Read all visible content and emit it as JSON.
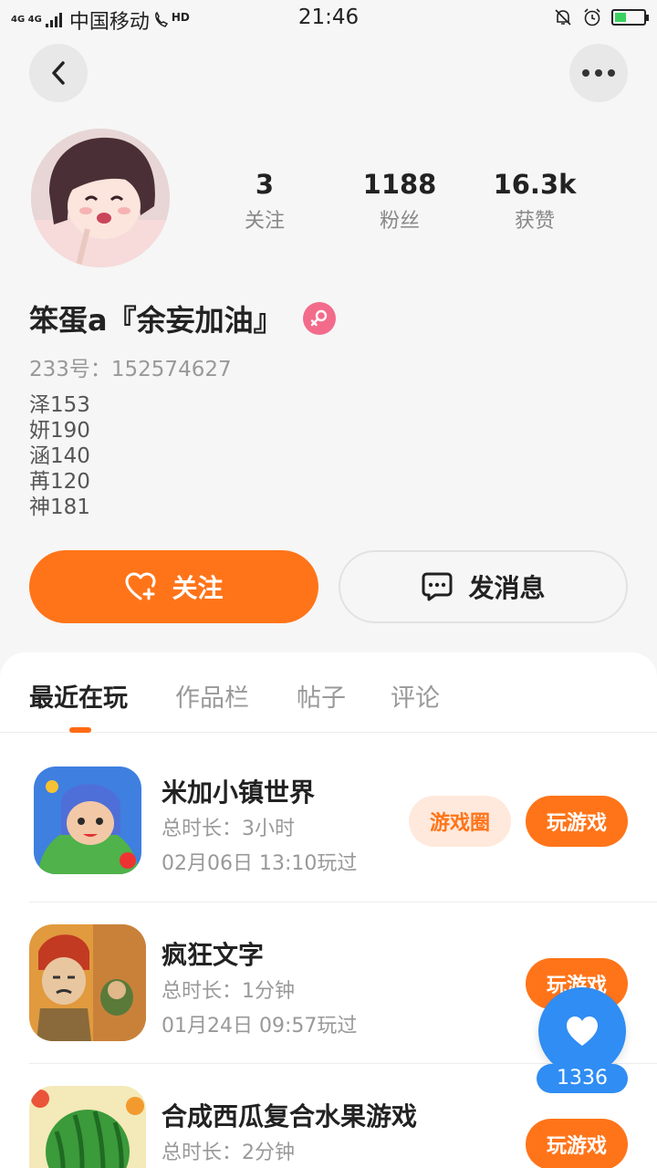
{
  "status_bar": {
    "network": "4G 4G",
    "carrier": "中国移动",
    "hd": "HD",
    "time": "21:46"
  },
  "profile": {
    "stats": [
      {
        "value": "3",
        "label": "关注"
      },
      {
        "value": "1188",
        "label": "粉丝"
      },
      {
        "value": "16.3k",
        "label": "获赞"
      }
    ],
    "name": "笨蛋a『余妄加油』",
    "uid": "233号：152574627",
    "bio": [
      "泽153",
      "妍190",
      "涵140",
      "苒120",
      "神181"
    ],
    "follow_label": "关注",
    "message_label": "发消息"
  },
  "tabs": [
    "最近在玩",
    "作品栏",
    "帖子",
    "评论"
  ],
  "games": [
    {
      "title": "米加小镇世界",
      "duration": "总时长：3小时",
      "last_played": "02月06日 13:10玩过",
      "circle_label": "游戏圈",
      "play_label": "玩游戏"
    },
    {
      "title": "疯狂文字",
      "duration": "总时长：1分钟",
      "last_played": "01月24日 09:57玩过",
      "play_label": "玩游戏"
    },
    {
      "title": "合成西瓜复合水果游戏",
      "duration": "总时长：2分钟",
      "play_label": "玩游戏"
    }
  ],
  "floating_like": {
    "count": "1336"
  },
  "colors": {
    "accent": "#ff7419",
    "like": "#2f8df3",
    "gender": "#f36b8a"
  }
}
